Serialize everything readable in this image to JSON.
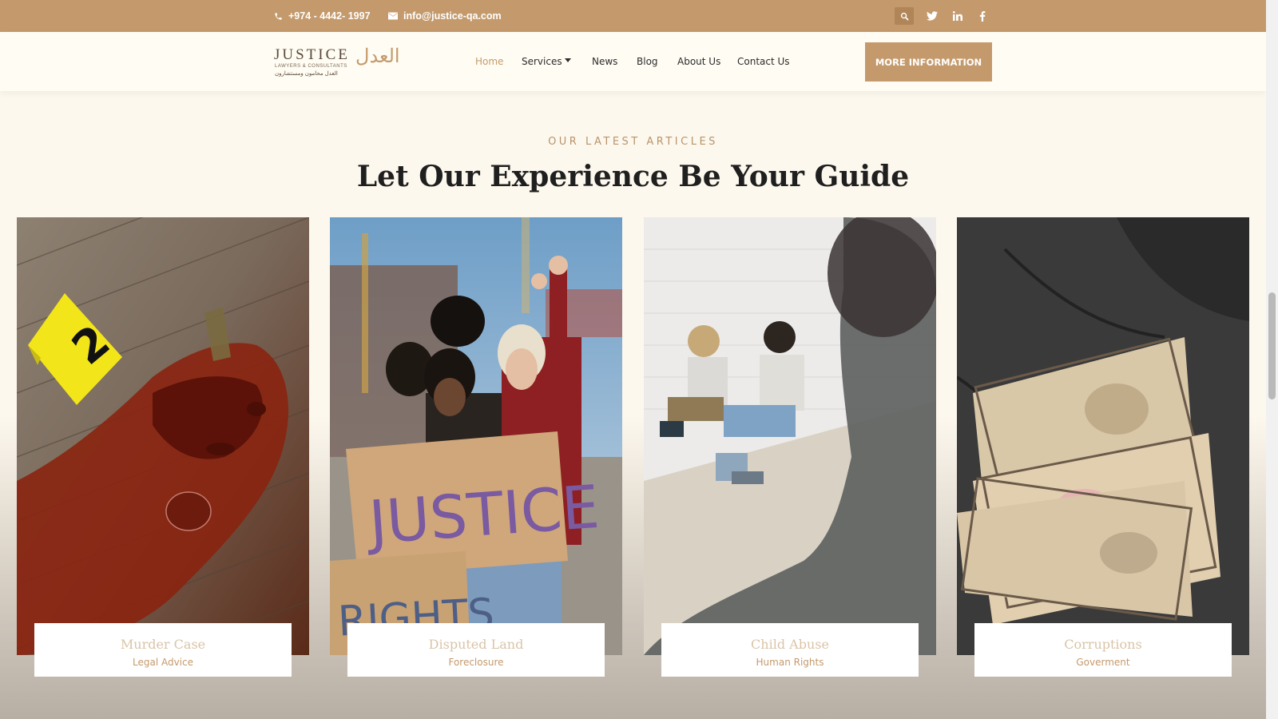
{
  "topbar": {
    "phone": "+974 - 4442- 1997",
    "email": "info@justice-qa.com",
    "icons": [
      "phone-icon",
      "mail-icon",
      "search-icon",
      "twitter-icon",
      "linkedin-icon",
      "facebook-icon"
    ]
  },
  "logo": {
    "name_en": "JUSTICE",
    "tagline_en": "LAWYERS & CONSULTANTS",
    "name_ar": "العدل",
    "tagline_ar": "العدل محامون ومستشارون"
  },
  "nav": {
    "items": [
      {
        "label": "Home",
        "active": true
      },
      {
        "label": "Services",
        "has_dropdown": true
      },
      {
        "label": "News"
      },
      {
        "label": "Blog"
      },
      {
        "label": "About Us"
      },
      {
        "label": "Contact Us"
      }
    ],
    "cta": "MORE INFORMATION"
  },
  "section": {
    "eyebrow": "OUR LATEST ARTICLES",
    "heading": "Let Our Experience Be Your Guide"
  },
  "articles": [
    {
      "title": "Murder Case",
      "category": "Legal Advice",
      "image": "crime-scene-photo"
    },
    {
      "title": "Disputed Land",
      "category": "Foreclosure",
      "image": "protest-photo"
    },
    {
      "title": "Child Abuse",
      "category": "Human Rights",
      "image": "children-photo"
    },
    {
      "title": "Corruptions",
      "category": "Goverment",
      "image": "money-photo"
    }
  ],
  "colors": {
    "brand": "#c49a6c",
    "background": "#fdf8ee",
    "nav_background": "#fffcf3",
    "heading": "#1f1f1f"
  }
}
